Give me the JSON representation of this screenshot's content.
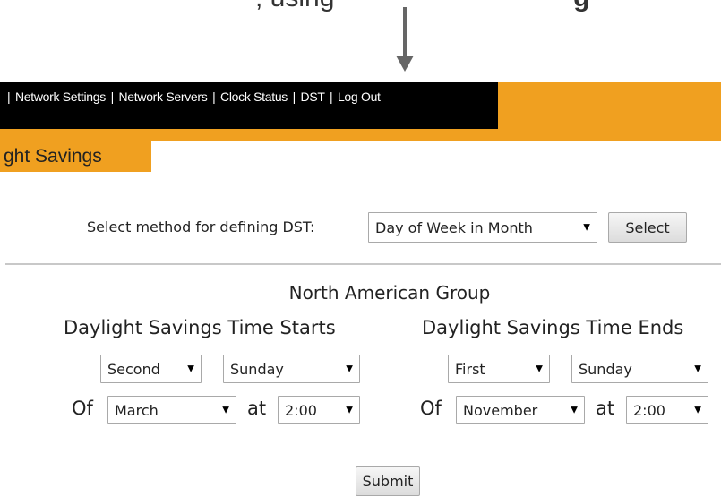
{
  "top_caption": {
    "text_plain": ", using",
    "text_bold": "g"
  },
  "nav": {
    "items": [
      {
        "label": "Network Settings"
      },
      {
        "label": "Network Servers"
      },
      {
        "label": "Clock Status"
      },
      {
        "label": "DST"
      },
      {
        "label": "Log Out"
      }
    ],
    "separator": "|"
  },
  "page_title": "ght Savings",
  "method": {
    "label": "Select method for defining DST:",
    "selected": "Day of Week in Month",
    "select_button": "Select"
  },
  "group_title": "North American Group",
  "dst_start": {
    "heading": "Daylight Savings Time Starts",
    "week": "Second",
    "day": "Sunday",
    "of_label": "Of",
    "month": "March",
    "at_label": "at",
    "time": "2:00"
  },
  "dst_end": {
    "heading": "Daylight Savings Time Ends",
    "week": "First",
    "day": "Sunday",
    "of_label": "Of",
    "month": "November",
    "at_label": "at",
    "time": "2:00"
  },
  "submit_label": "Submit",
  "caret_glyph": "▼",
  "colors": {
    "accent_orange": "#f0a020",
    "nav_black": "#000000",
    "divider": "#c8c8c8"
  }
}
